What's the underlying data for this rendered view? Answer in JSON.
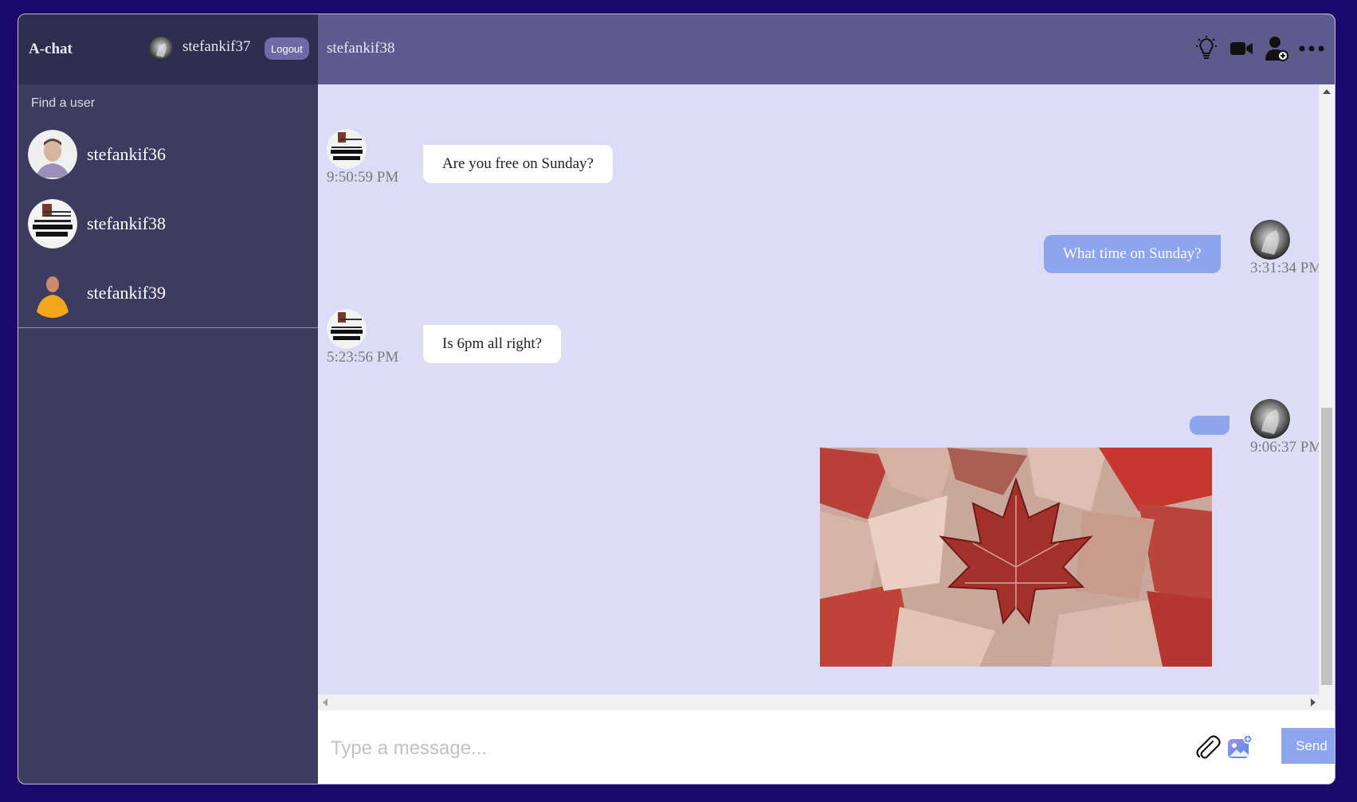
{
  "app": {
    "name": "A-chat"
  },
  "current_user": {
    "name": "stefankif37",
    "logout_label": "Logout"
  },
  "search": {
    "placeholder": "Find a user"
  },
  "users": [
    {
      "name": "stefankif36"
    },
    {
      "name": "stefankif38"
    },
    {
      "name": "stefankif39"
    }
  ],
  "chat": {
    "title": "stefankif38",
    "icons": [
      "lightbulb-icon",
      "video-camera-icon",
      "add-user-icon",
      "more-icon"
    ],
    "messages": [
      {
        "direction": "incoming",
        "text": "Are you free on Sunday?",
        "time": "9:50:59 PM"
      },
      {
        "direction": "outgoing",
        "text": "What time on Sunday?",
        "time": "3:31:34 PM"
      },
      {
        "direction": "incoming",
        "text": "Is 6pm all right?",
        "time": "5:23:56 PM"
      },
      {
        "direction": "outgoing",
        "text": "",
        "time": "9:06:37 PM",
        "image": "red maple leaves photo"
      }
    ]
  },
  "composer": {
    "placeholder": "Type a message...",
    "send_label": "Send"
  },
  "colors": {
    "page_bg": "#1b0a6b",
    "sidebar": "#3d3b5f",
    "sidebar_header": "#2f2d50",
    "chat_header": "#5d5b8d",
    "chat_bg": "#dcdcf6",
    "outgoing_bubble": "#8da4ef"
  }
}
